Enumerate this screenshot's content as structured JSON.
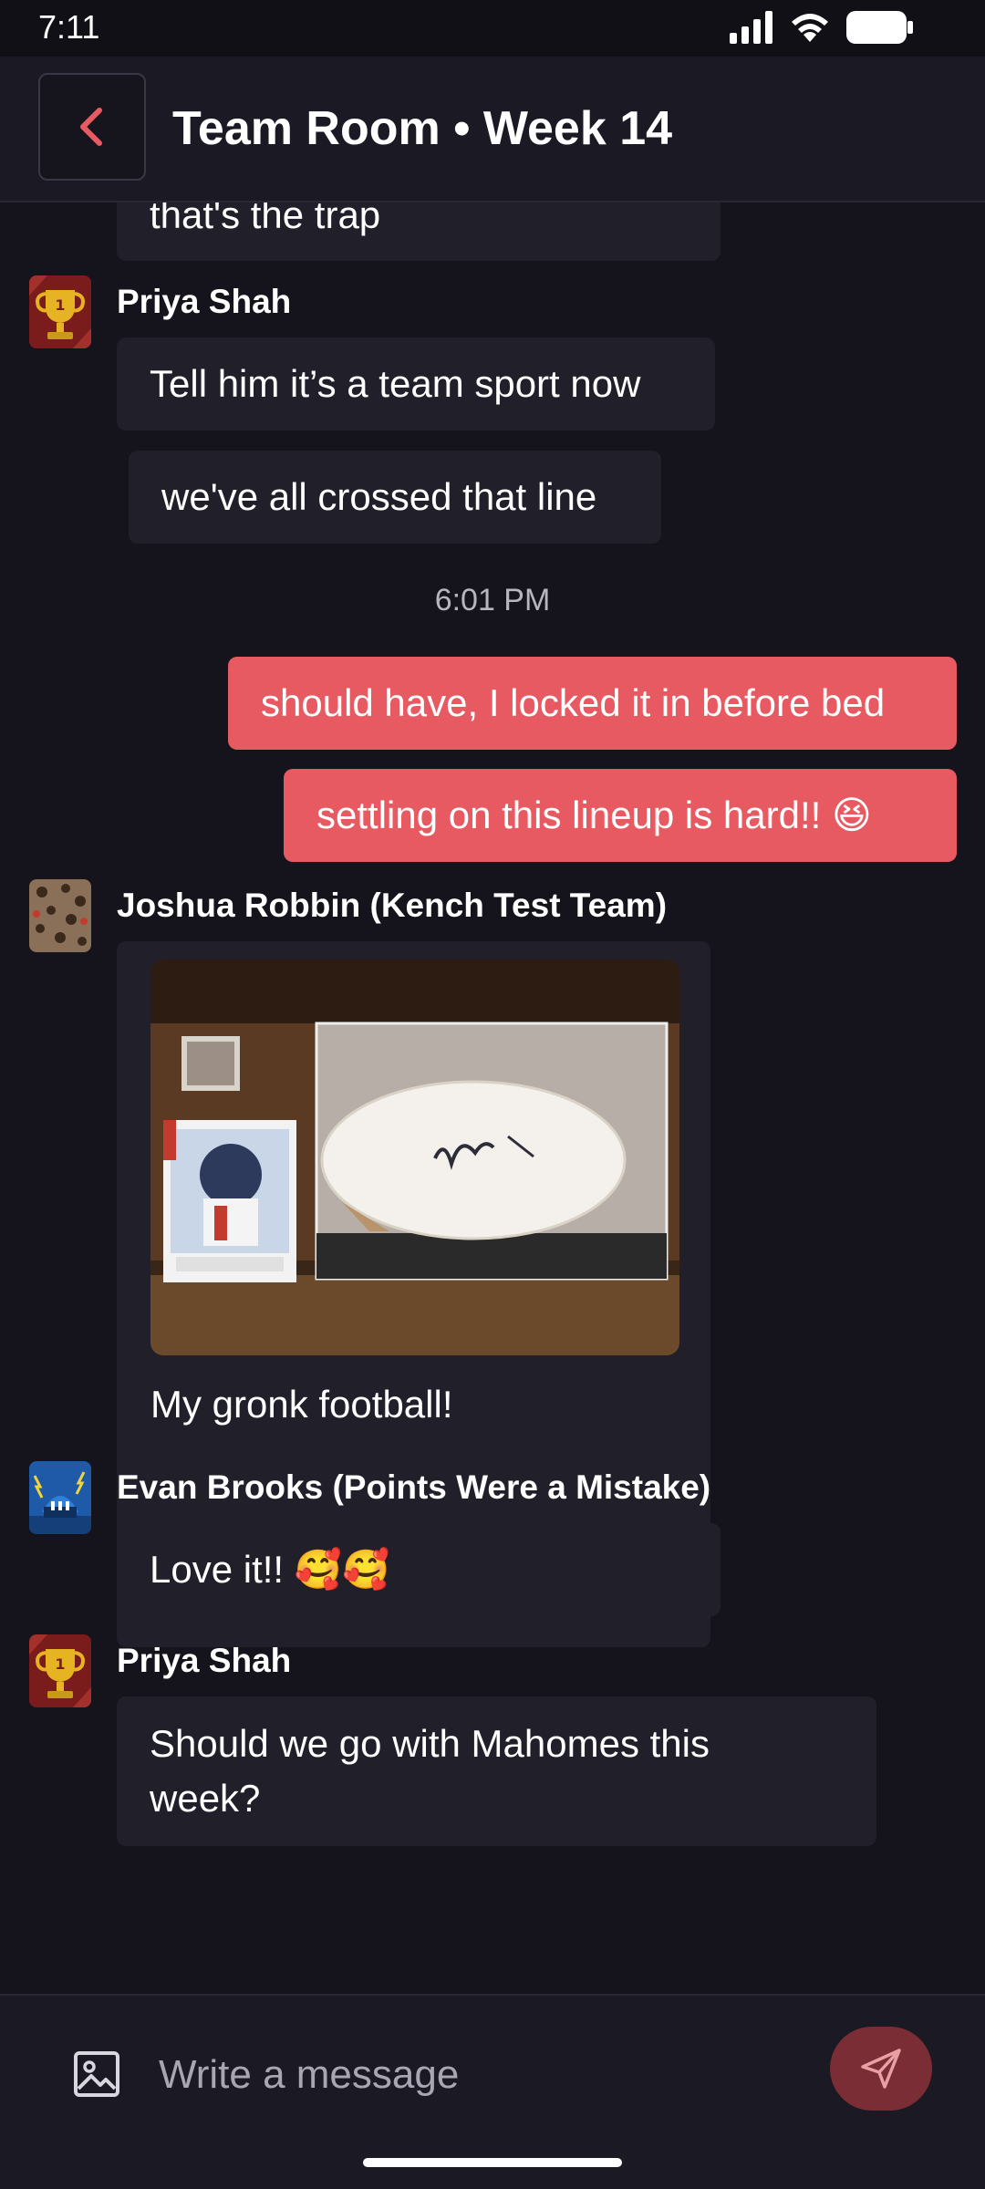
{
  "status_bar": {
    "time": "7:11",
    "icons": [
      "signal-icon",
      "wifi-icon",
      "battery-icon"
    ]
  },
  "header": {
    "back_icon": "chevron-left-icon",
    "title": "Team Room • Week 14"
  },
  "colors": {
    "accent": "#e85a62",
    "background": "#15131b",
    "bubble": "#211f2a"
  },
  "messages": [
    {
      "text": "that's the trap"
    },
    {
      "sender": "Priya Shah",
      "avatar": "trophy-avatar",
      "text": "Tell him it’s a team sport now"
    },
    {
      "text": "we've all crossed that line"
    },
    {
      "timestamp": "6:01 PM"
    },
    {
      "mine": true,
      "text": "should have, I locked it in before bed"
    },
    {
      "mine": true,
      "text": "settling on this lineup is hard!! 😆"
    },
    {
      "sender": "Joshua Robbin (Kench Test Team)",
      "avatar": "cheetah-avatar",
      "image": "signed-football-photo",
      "text": "My gronk football!"
    },
    {
      "sender": "Evan Brooks (Points Were a Mistake)",
      "avatar": "stadium-avatar",
      "text": "Love it!! 🥰🥰"
    },
    {
      "sender": "Priya Shah",
      "avatar": "trophy-avatar",
      "text_lines": [
        "Should we go with Mahomes this",
        "week?"
      ]
    }
  ],
  "composer": {
    "attach_icon": "image-icon",
    "placeholder": "Write a message",
    "send_icon": "send-icon"
  }
}
